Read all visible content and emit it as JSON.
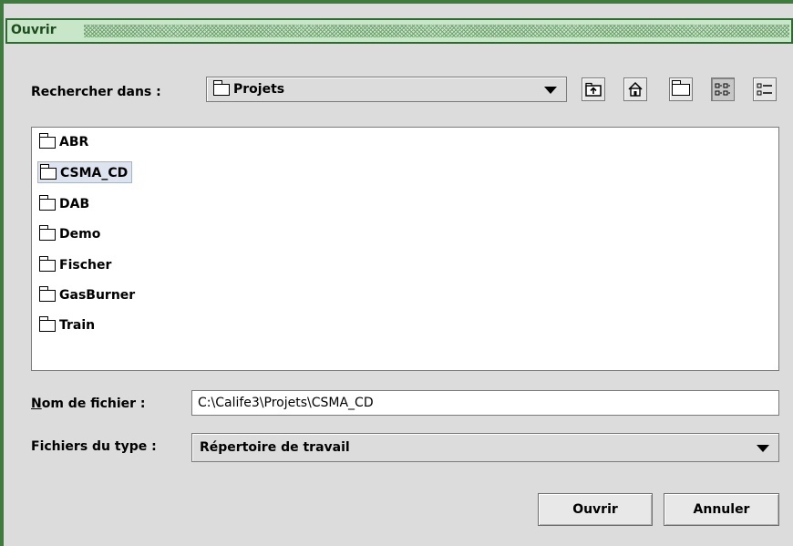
{
  "window": {
    "title": "Ouvrir"
  },
  "look_in": {
    "label": "Rechercher dans :",
    "value": "Projets"
  },
  "toolbar": {
    "icons": [
      "up-folder-icon",
      "home-icon",
      "new-folder-icon",
      "list-view-icon",
      "details-view-icon"
    ]
  },
  "files": [
    {
      "name": "ABR",
      "selected": false
    },
    {
      "name": "CSMA_CD",
      "selected": true
    },
    {
      "name": "DAB",
      "selected": false
    },
    {
      "name": "Demo",
      "selected": false
    },
    {
      "name": "Fischer",
      "selected": false
    },
    {
      "name": "GasBurner",
      "selected": false
    },
    {
      "name": "Train",
      "selected": false
    }
  ],
  "filename": {
    "label_mnemonic": "N",
    "label_rest": "om de fichier :",
    "value": "C:\\Calife3\\Projets\\CSMA_CD"
  },
  "filetype": {
    "label": "Fichiers du type :",
    "value": "Répertoire de travail"
  },
  "buttons": {
    "open": "Ouvrir",
    "cancel": "Annuler"
  }
}
